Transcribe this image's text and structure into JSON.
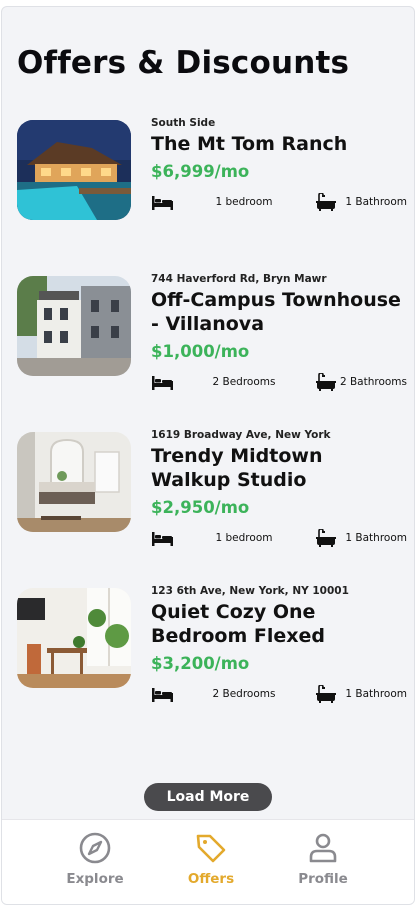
{
  "page": {
    "title": "Offers & Discounts"
  },
  "listings": [
    {
      "address": "South Side",
      "name": "The Mt Tom Ranch",
      "price": "$6,999/mo",
      "bedrooms": "1 bedroom",
      "bathrooms": "1 Bathroom"
    },
    {
      "address": "744 Haverford Rd, Bryn Mawr",
      "name": "Off-Campus Townhouse - Villanova",
      "price": "$1,000/mo",
      "bedrooms": "2 Bedrooms",
      "bathrooms": "2 Bathrooms"
    },
    {
      "address": "1619 Broadway Ave, New York",
      "name": "Trendy Midtown Walkup Studio",
      "price": "$2,950/mo",
      "bedrooms": "1 bedroom",
      "bathrooms": "1 Bathroom"
    },
    {
      "address": "123 6th Ave, New York, NY 10001",
      "name": "Quiet Cozy One Bedroom Flexed",
      "price": "$3,200/mo",
      "bedrooms": "2 Bedrooms",
      "bathrooms": "1 Bathroom"
    }
  ],
  "load_more": "Load More",
  "tabs": [
    {
      "label": "Explore",
      "icon": "compass-icon",
      "active": false
    },
    {
      "label": "Offers",
      "icon": "tag-icon",
      "active": true
    },
    {
      "label": "Profile",
      "icon": "person-icon",
      "active": false
    }
  ],
  "colors": {
    "price": "#3cb35a",
    "active_tab": "#e3a92c",
    "inactive_tab": "#8a8a8f",
    "button": "#4a4a4d"
  }
}
